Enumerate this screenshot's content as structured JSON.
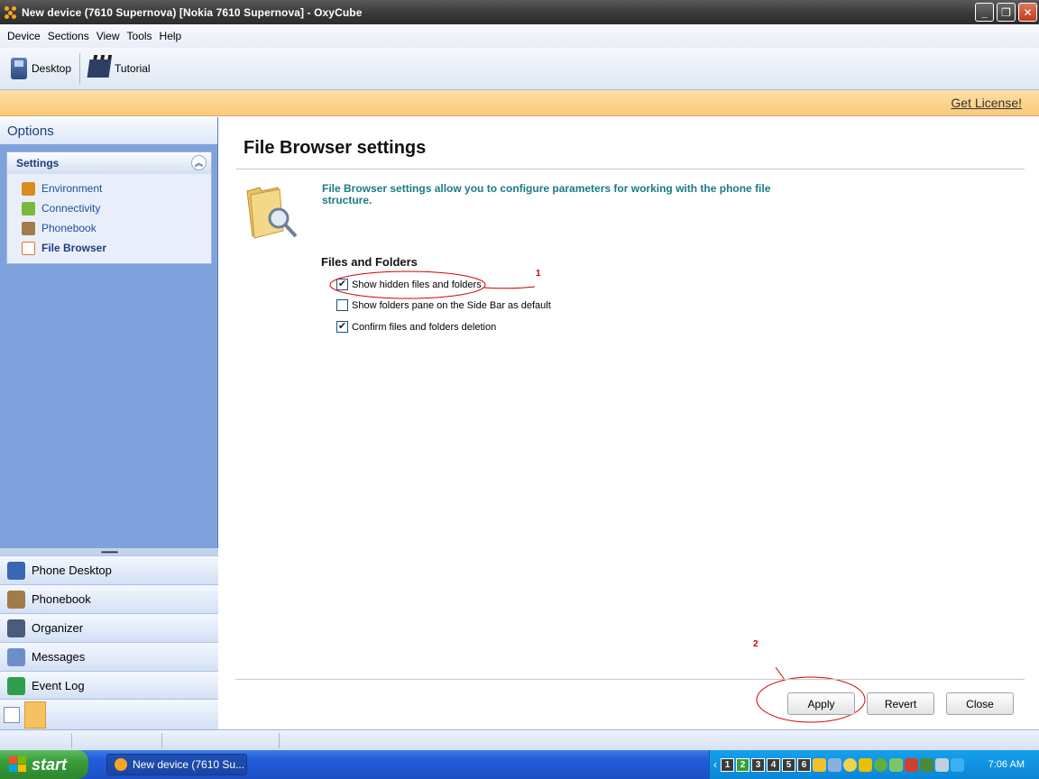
{
  "window": {
    "title": "New device (7610 Supernova) [Nokia 7610 Supernova] - OxyCube",
    "minimize": "_",
    "restore": "❐",
    "close": "✕"
  },
  "menu": [
    "Device",
    "Sections",
    "View",
    "Tools",
    "Help"
  ],
  "toolbar": {
    "desktop": "Desktop",
    "tutorial": "Tutorial"
  },
  "license": {
    "link": "Get License!"
  },
  "sidebar": {
    "header": "Options",
    "panel": {
      "title": "Settings",
      "items": [
        {
          "label": "Environment",
          "icon": "environment-icon",
          "color": "#d98c1f"
        },
        {
          "label": "Connectivity",
          "icon": "connectivity-icon",
          "color": "#7cb83a"
        },
        {
          "label": "Phonebook",
          "icon": "phonebook-icon",
          "color": "#a07c4a"
        },
        {
          "label": "File Browser",
          "icon": "file-browser-icon",
          "color": "#e0742b",
          "active": true
        }
      ]
    },
    "nav": [
      {
        "label": "Phone Desktop",
        "icon": "phone-desktop-icon",
        "color": "#3a68b0"
      },
      {
        "label": "Phonebook",
        "icon": "phonebook-icon",
        "color": "#a07c4a"
      },
      {
        "label": "Organizer",
        "icon": "organizer-icon",
        "color": "#4b5c7a"
      },
      {
        "label": "Messages",
        "icon": "messages-icon",
        "color": "#6d8fc9"
      },
      {
        "label": "Event Log",
        "icon": "event-log-icon",
        "color": "#2e9e4a"
      }
    ]
  },
  "main": {
    "title": "File Browser settings",
    "intro": "File Browser settings allow you to configure parameters for working with the phone file structure.",
    "group_title": "Files and Folders",
    "options": [
      {
        "label": "Show hidden files and folders",
        "checked": true
      },
      {
        "label": "Show folders pane on the Side Bar as default",
        "checked": false
      },
      {
        "label": "Confirm files and folders deletion",
        "checked": true
      }
    ],
    "buttons": {
      "apply": "Apply",
      "revert": "Revert",
      "close": "Close"
    },
    "annotations": {
      "one": "1",
      "two": "2"
    }
  },
  "taskbar": {
    "start": "start",
    "task": "New device (7610 Su...",
    "desktops": [
      "1",
      "2",
      "3",
      "4",
      "5",
      "6"
    ],
    "active_desktop": "2",
    "clock": "7:06 AM"
  }
}
